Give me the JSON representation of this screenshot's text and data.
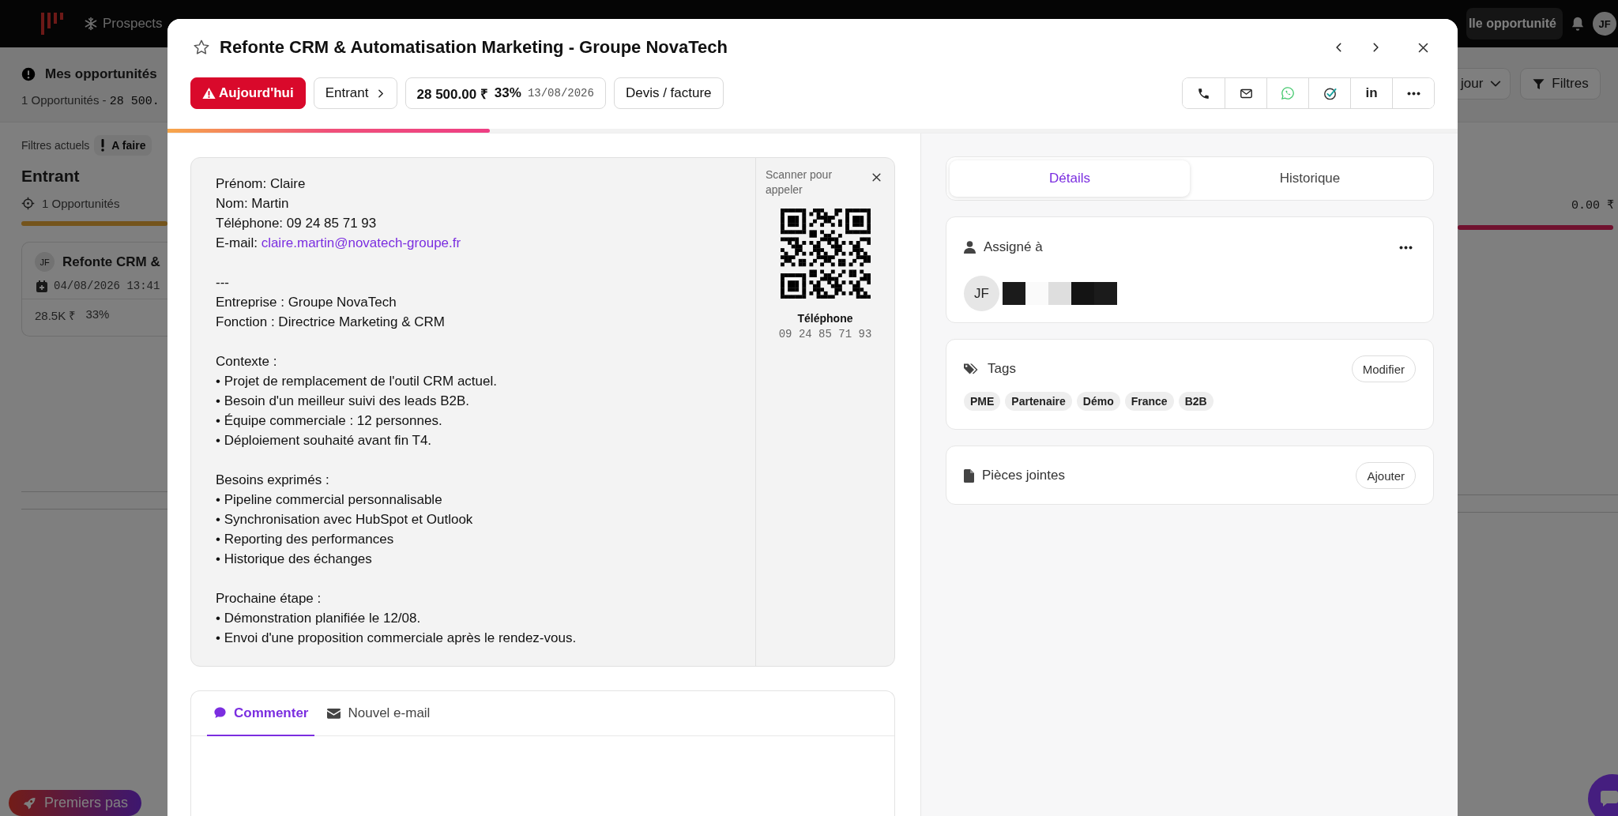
{
  "top_bar": {
    "nav_item": "Prospects",
    "new_button": "lle opportunité",
    "avatar": "JF"
  },
  "background": {
    "left": {
      "title": "Mes opportunités",
      "summary_label": "1 Opportunités -",
      "summary_amount": "28 500.",
      "filters_label": "Filtres actuels",
      "filter_chip": "A faire",
      "column_title": "Entrant",
      "column_count": "1 Opportunités",
      "card": {
        "avatar": "JF",
        "title": "Refonte CRM &",
        "date": "04/08/2026 13:41",
        "amount": "28.5K ₹",
        "percent": "33%"
      },
      "onboarding_button": "Premiers pas"
    },
    "right": {
      "period_button": "jour",
      "filters_button": "Filtres",
      "column_total": "0.00 ₹"
    }
  },
  "modal": {
    "title": "Refonte CRM & Automatisation Marketing - Groupe NovaTech",
    "starred": false,
    "badges": [
      {
        "kind": "due",
        "label": "Aujourd'hui"
      },
      {
        "kind": "stage",
        "label": "Entrant"
      },
      {
        "kind": "amount",
        "amount": "28 500.00 ₹",
        "percent": "33%",
        "date": "13/08/2026"
      },
      {
        "kind": "plain",
        "label": "Devis / facture"
      }
    ],
    "actions": [
      {
        "kind": "phone"
      },
      {
        "kind": "mail"
      },
      {
        "kind": "whatsapp"
      },
      {
        "kind": "check"
      },
      {
        "kind": "linkedin",
        "label": "in"
      },
      {
        "kind": "more"
      }
    ],
    "progress": {
      "level": 0.25
    },
    "note": {
      "blocks": [
        {
          "lines": [
            {
              "text": "Prénom: Claire"
            },
            {
              "text": "Nom: Martin"
            },
            {
              "text": "Téléphone: 09 24 85 71 93"
            },
            {
              "text": "E-mail:",
              "link": "claire.martin@novatech-groupe.fr"
            }
          ]
        },
        {
          "lines": [
            {
              "text": "---"
            },
            {
              "text": "Entreprise : Groupe NovaTech"
            },
            {
              "text": "Fonction : Directrice Marketing & CRM"
            }
          ]
        },
        {
          "lines": [
            {
              "text": "Contexte :"
            },
            {
              "text": "• Projet de remplacement de l'outil CRM actuel."
            },
            {
              "text": "• Besoin d'un meilleur suivi des leads B2B."
            },
            {
              "text": "• Équipe commerciale : 12 personnes."
            },
            {
              "text": "• Déploiement souhaité avant fin T4."
            }
          ]
        },
        {
          "lines": [
            {
              "text": "Besoins exprimés :"
            },
            {
              "text": "• Pipeline commercial personnalisable"
            },
            {
              "text": "• Synchronisation avec HubSpot et Outlook"
            },
            {
              "text": "• Reporting des performances"
            },
            {
              "text": "• Historique des échanges"
            }
          ]
        },
        {
          "lines": [
            {
              "text": "Prochaine étape :"
            },
            {
              "text": "• Démonstration planifiée le 12/08."
            },
            {
              "text": "• Envoi d'une proposition commerciale après le rendez-vous."
            }
          ]
        }
      ],
      "qr": {
        "caption": "Scanner pour appeler",
        "label": "Téléphone",
        "number": "09 24 85 71 93"
      }
    },
    "composer": {
      "tabs": [
        {
          "label": "Commenter",
          "selected": true
        },
        {
          "label": "Nouvel e-mail",
          "selected": false
        }
      ]
    },
    "side": {
      "tabs": [
        {
          "label": "Détails",
          "selected": true
        },
        {
          "label": "Historique",
          "selected": false
        }
      ],
      "assigned": {
        "title": "Assigné à",
        "avatar": "JF"
      },
      "tags": {
        "title": "Tags",
        "button": "Modifier",
        "items": [
          "PME",
          "Partenaire",
          "Démo",
          "France",
          "B2B"
        ]
      },
      "attachments": {
        "title": "Pièces jointes",
        "button": "Ajouter"
      }
    }
  }
}
